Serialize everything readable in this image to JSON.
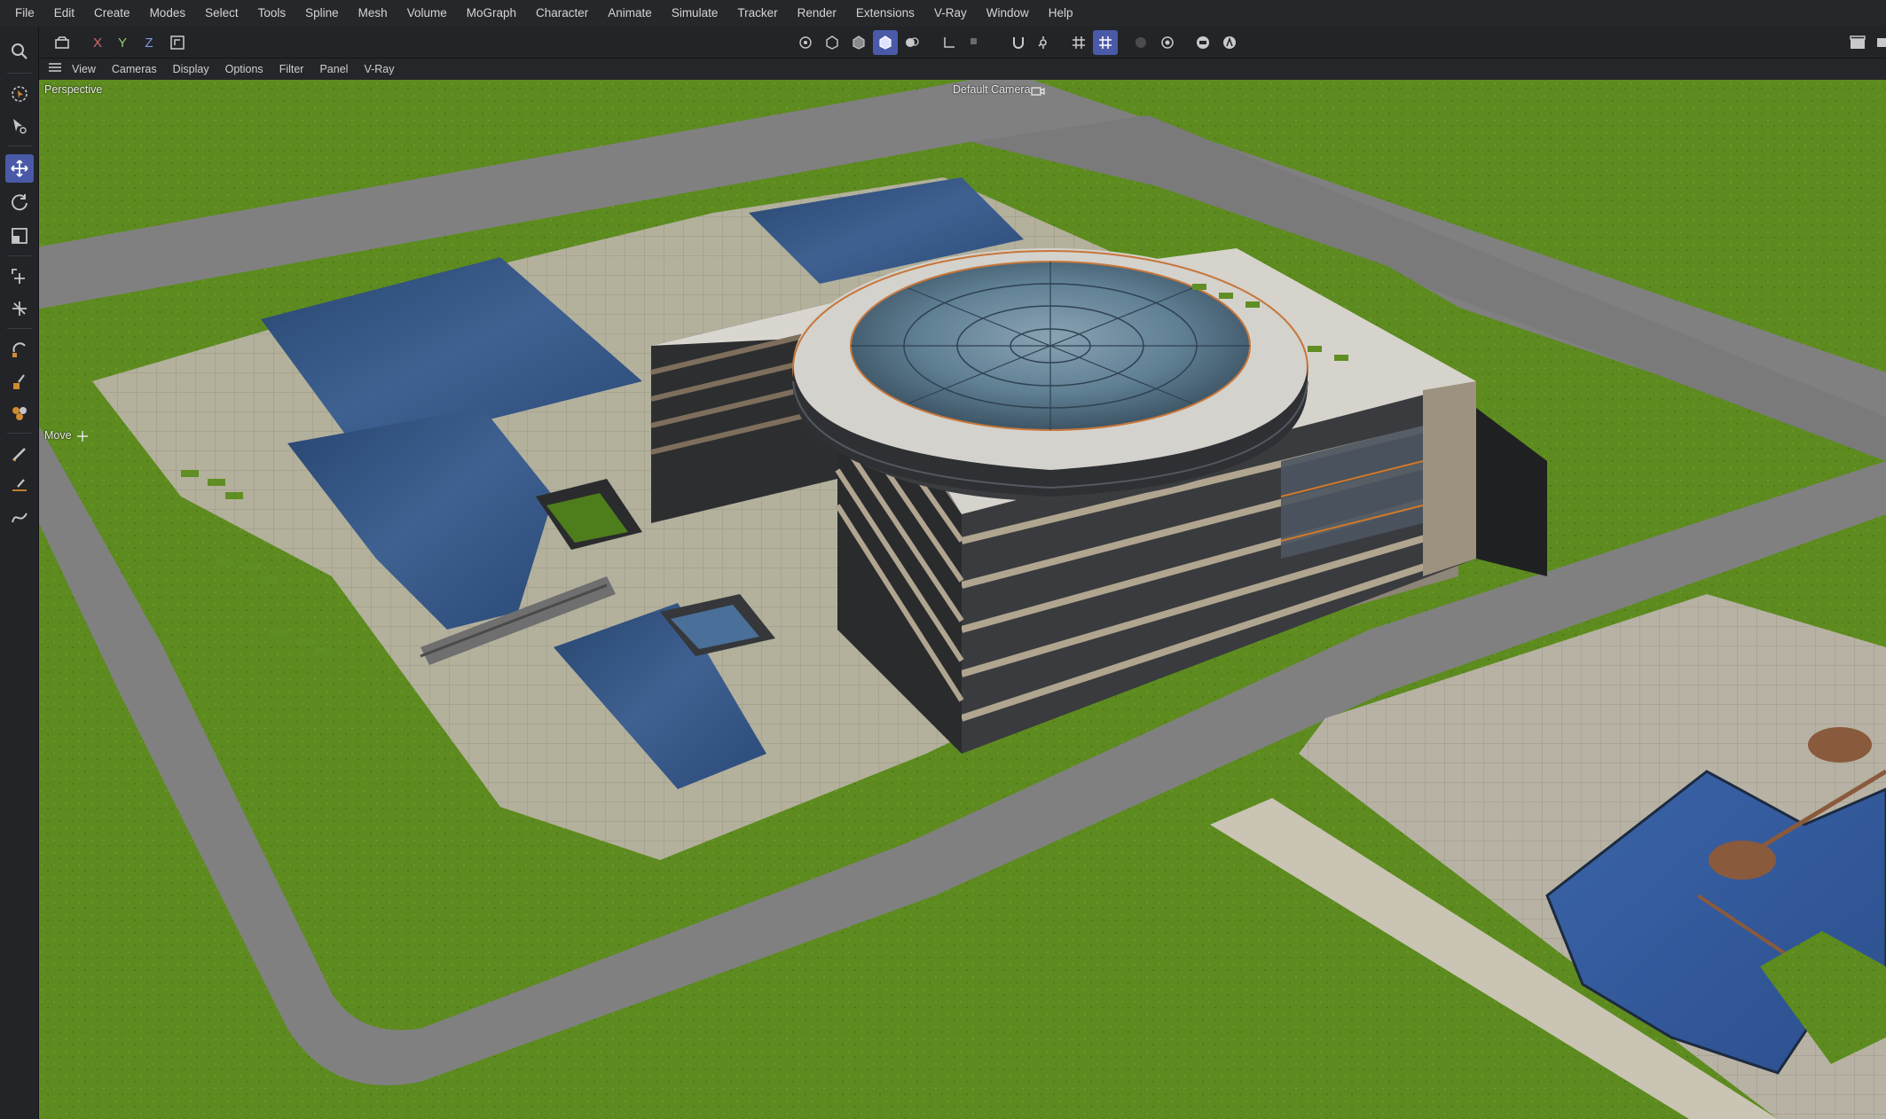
{
  "menubar": {
    "items": [
      "File",
      "Edit",
      "Create",
      "Modes",
      "Select",
      "Tools",
      "Spline",
      "Mesh",
      "Volume",
      "MoGraph",
      "Character",
      "Animate",
      "Simulate",
      "Tracker",
      "Render",
      "Extensions",
      "V-Ray",
      "Window",
      "Help"
    ]
  },
  "toolbar": {
    "axis_x": "X",
    "axis_y": "Y",
    "axis_z": "Z"
  },
  "viewmenu": {
    "items": [
      "View",
      "Cameras",
      "Display",
      "Options",
      "Filter",
      "Panel",
      "V-Ray"
    ]
  },
  "viewport": {
    "view_label": "Perspective",
    "camera_label": "Default Camera",
    "tool_label": "Move"
  },
  "colors": {
    "accent": "#4a5aa8",
    "grass": "#5c8a1f",
    "road": "#7f7f80",
    "water": "#2f4e78"
  },
  "icons": [
    "search-icon",
    "live-selection-icon",
    "select-tool-icon",
    "move-icon",
    "rotate-icon",
    "scale-icon",
    "transform-icon",
    "snap-icon",
    "brush-icon",
    "paint-icon",
    "sculpt-icon",
    "knife-icon",
    "magnet-icon",
    "spline-icon"
  ]
}
